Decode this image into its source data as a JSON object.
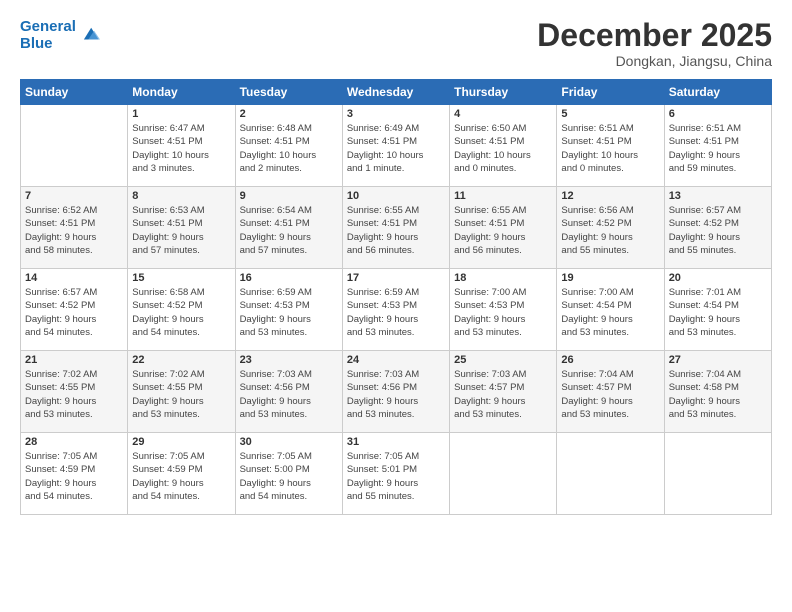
{
  "header": {
    "logo_line1": "General",
    "logo_line2": "Blue",
    "month_title": "December 2025",
    "subtitle": "Dongkan, Jiangsu, China"
  },
  "days_of_week": [
    "Sunday",
    "Monday",
    "Tuesday",
    "Wednesday",
    "Thursday",
    "Friday",
    "Saturday"
  ],
  "weeks": [
    [
      {
        "day": "",
        "info": ""
      },
      {
        "day": "1",
        "info": "Sunrise: 6:47 AM\nSunset: 4:51 PM\nDaylight: 10 hours\nand 3 minutes."
      },
      {
        "day": "2",
        "info": "Sunrise: 6:48 AM\nSunset: 4:51 PM\nDaylight: 10 hours\nand 2 minutes."
      },
      {
        "day": "3",
        "info": "Sunrise: 6:49 AM\nSunset: 4:51 PM\nDaylight: 10 hours\nand 1 minute."
      },
      {
        "day": "4",
        "info": "Sunrise: 6:50 AM\nSunset: 4:51 PM\nDaylight: 10 hours\nand 0 minutes."
      },
      {
        "day": "5",
        "info": "Sunrise: 6:51 AM\nSunset: 4:51 PM\nDaylight: 10 hours\nand 0 minutes."
      },
      {
        "day": "6",
        "info": "Sunrise: 6:51 AM\nSunset: 4:51 PM\nDaylight: 9 hours\nand 59 minutes."
      }
    ],
    [
      {
        "day": "7",
        "info": "Sunrise: 6:52 AM\nSunset: 4:51 PM\nDaylight: 9 hours\nand 58 minutes."
      },
      {
        "day": "8",
        "info": "Sunrise: 6:53 AM\nSunset: 4:51 PM\nDaylight: 9 hours\nand 57 minutes."
      },
      {
        "day": "9",
        "info": "Sunrise: 6:54 AM\nSunset: 4:51 PM\nDaylight: 9 hours\nand 57 minutes."
      },
      {
        "day": "10",
        "info": "Sunrise: 6:55 AM\nSunset: 4:51 PM\nDaylight: 9 hours\nand 56 minutes."
      },
      {
        "day": "11",
        "info": "Sunrise: 6:55 AM\nSunset: 4:51 PM\nDaylight: 9 hours\nand 56 minutes."
      },
      {
        "day": "12",
        "info": "Sunrise: 6:56 AM\nSunset: 4:52 PM\nDaylight: 9 hours\nand 55 minutes."
      },
      {
        "day": "13",
        "info": "Sunrise: 6:57 AM\nSunset: 4:52 PM\nDaylight: 9 hours\nand 55 minutes."
      }
    ],
    [
      {
        "day": "14",
        "info": "Sunrise: 6:57 AM\nSunset: 4:52 PM\nDaylight: 9 hours\nand 54 minutes."
      },
      {
        "day": "15",
        "info": "Sunrise: 6:58 AM\nSunset: 4:52 PM\nDaylight: 9 hours\nand 54 minutes."
      },
      {
        "day": "16",
        "info": "Sunrise: 6:59 AM\nSunset: 4:53 PM\nDaylight: 9 hours\nand 53 minutes."
      },
      {
        "day": "17",
        "info": "Sunrise: 6:59 AM\nSunset: 4:53 PM\nDaylight: 9 hours\nand 53 minutes."
      },
      {
        "day": "18",
        "info": "Sunrise: 7:00 AM\nSunset: 4:53 PM\nDaylight: 9 hours\nand 53 minutes."
      },
      {
        "day": "19",
        "info": "Sunrise: 7:00 AM\nSunset: 4:54 PM\nDaylight: 9 hours\nand 53 minutes."
      },
      {
        "day": "20",
        "info": "Sunrise: 7:01 AM\nSunset: 4:54 PM\nDaylight: 9 hours\nand 53 minutes."
      }
    ],
    [
      {
        "day": "21",
        "info": "Sunrise: 7:02 AM\nSunset: 4:55 PM\nDaylight: 9 hours\nand 53 minutes."
      },
      {
        "day": "22",
        "info": "Sunrise: 7:02 AM\nSunset: 4:55 PM\nDaylight: 9 hours\nand 53 minutes."
      },
      {
        "day": "23",
        "info": "Sunrise: 7:03 AM\nSunset: 4:56 PM\nDaylight: 9 hours\nand 53 minutes."
      },
      {
        "day": "24",
        "info": "Sunrise: 7:03 AM\nSunset: 4:56 PM\nDaylight: 9 hours\nand 53 minutes."
      },
      {
        "day": "25",
        "info": "Sunrise: 7:03 AM\nSunset: 4:57 PM\nDaylight: 9 hours\nand 53 minutes."
      },
      {
        "day": "26",
        "info": "Sunrise: 7:04 AM\nSunset: 4:57 PM\nDaylight: 9 hours\nand 53 minutes."
      },
      {
        "day": "27",
        "info": "Sunrise: 7:04 AM\nSunset: 4:58 PM\nDaylight: 9 hours\nand 53 minutes."
      }
    ],
    [
      {
        "day": "28",
        "info": "Sunrise: 7:05 AM\nSunset: 4:59 PM\nDaylight: 9 hours\nand 54 minutes."
      },
      {
        "day": "29",
        "info": "Sunrise: 7:05 AM\nSunset: 4:59 PM\nDaylight: 9 hours\nand 54 minutes."
      },
      {
        "day": "30",
        "info": "Sunrise: 7:05 AM\nSunset: 5:00 PM\nDaylight: 9 hours\nand 54 minutes."
      },
      {
        "day": "31",
        "info": "Sunrise: 7:05 AM\nSunset: 5:01 PM\nDaylight: 9 hours\nand 55 minutes."
      },
      {
        "day": "",
        "info": ""
      },
      {
        "day": "",
        "info": ""
      },
      {
        "day": "",
        "info": ""
      }
    ]
  ]
}
